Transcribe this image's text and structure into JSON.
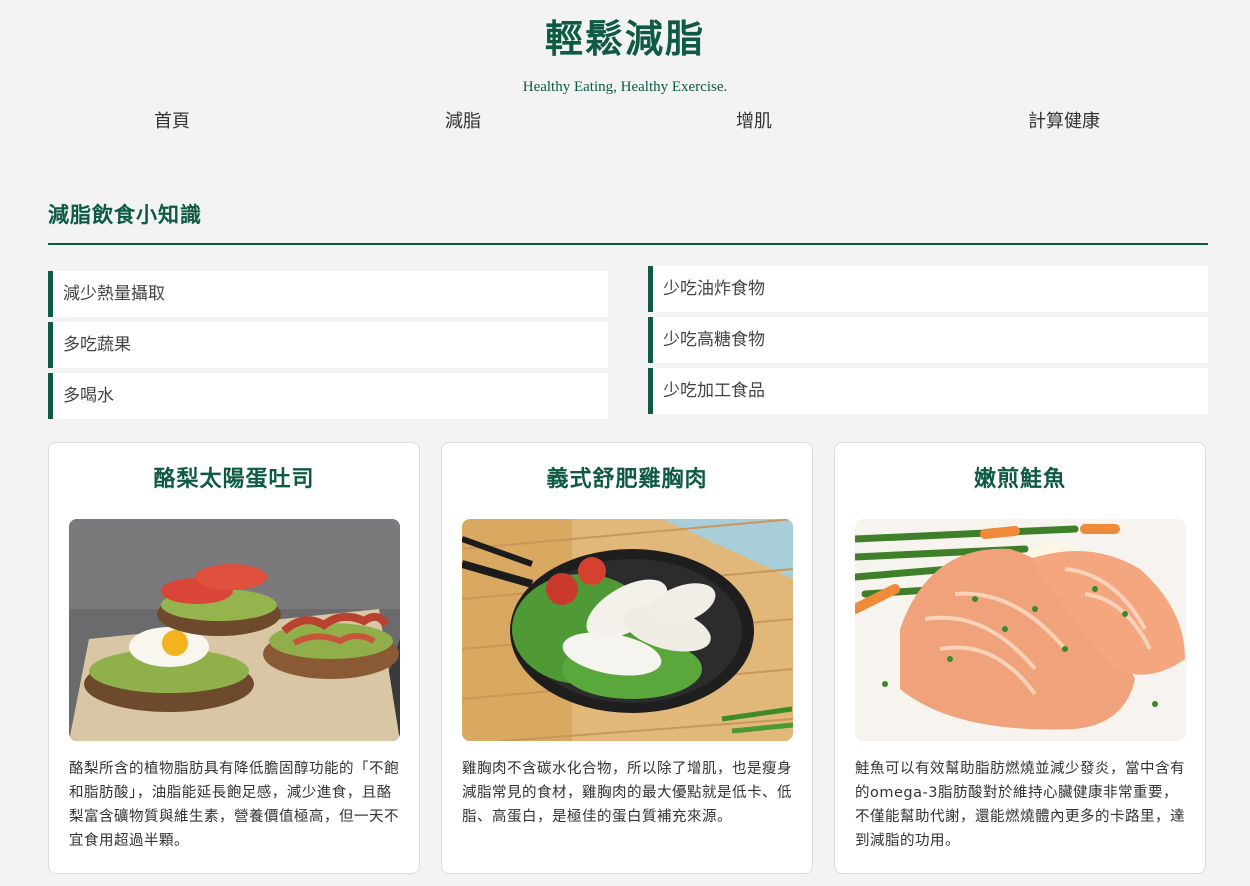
{
  "header": {
    "title": "輕鬆減脂",
    "tagline": "Healthy Eating, Healthy Exercise."
  },
  "nav": {
    "items": [
      {
        "label": "首頁"
      },
      {
        "label": "減脂"
      },
      {
        "label": "增肌"
      },
      {
        "label": "計算健康"
      }
    ]
  },
  "section": {
    "title": "減脂飲食小知識"
  },
  "tips": {
    "left": [
      "減少熱量攝取",
      "多吃蔬果",
      "多喝水"
    ],
    "right": [
      "少吃油炸食物",
      "少吃高糖食物",
      "少吃加工食品"
    ]
  },
  "cards": [
    {
      "title": "酪梨太陽蛋吐司",
      "image_icon": "avocado-toast-photo",
      "text": "酪梨所含的植物脂肪具有降低膽固醇功能的「不飽和脂肪酸」，油脂能延長飽足感，減少進食，且酪梨富含礦物質與維生素，營養價值極高，但一天不宜食用超過半顆。"
    },
    {
      "title": "義式舒肥雞胸肉",
      "image_icon": "chicken-breast-photo",
      "text": "雞胸肉不含碳水化合物，所以除了增肌，也是瘦身減脂常見的食材，雞胸肉的最大優點就是低卡、低脂、高蛋白，是極佳的蛋白質補充來源。"
    },
    {
      "title": "嫩煎鮭魚",
      "image_icon": "salmon-photo",
      "text": "鮭魚可以有效幫助脂肪燃燒並減少發炎，當中含有的omega-3脂肪酸對於維持心臟健康非常重要，不僅能幫助代謝，還能燃燒體內更多的卡路里，達到減脂的功用。"
    }
  ],
  "colors": {
    "brand": "#0e5a44",
    "background": "#f3f3f4"
  }
}
